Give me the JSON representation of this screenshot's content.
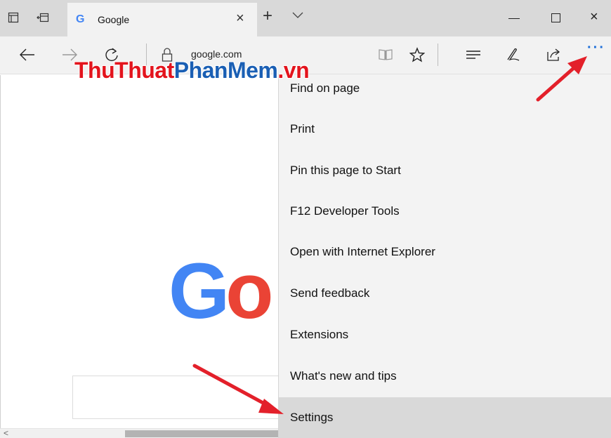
{
  "tab": {
    "title": "Google",
    "favicon_letter": "G"
  },
  "icons": {
    "tab-list": "tab-list-icon",
    "set-aside": "set-aside-tabs-icon",
    "new-tab": "plus-icon",
    "tab-preview": "chevron-down-icon",
    "back": "back-arrow-icon",
    "forward": "forward-arrow-icon",
    "refresh": "refresh-icon",
    "lock": "lock-icon",
    "reading-view": "book-icon",
    "favorite": "star-icon",
    "hub": "hub-icon",
    "web-note": "pen-icon",
    "share": "share-icon",
    "more": "more-dots-icon"
  },
  "window": {
    "close_glyph": "×",
    "tab_close_glyph": "×",
    "new_tab_glyph": "+"
  },
  "address": {
    "url": "google.com"
  },
  "watermark": {
    "part1": "ThuThuat",
    "part2": "PhanMem",
    "part3": ".vn"
  },
  "page": {
    "logo_letters": [
      "G",
      "o"
    ],
    "scroll_left_glyph": "<"
  },
  "menu": {
    "items": [
      {
        "label": "Find on page"
      },
      {
        "label": "Print"
      },
      {
        "label": "Pin this page to Start"
      },
      {
        "label": "F12 Developer Tools"
      },
      {
        "label": "Open with Internet Explorer"
      },
      {
        "label": "Send feedback"
      },
      {
        "label": "Extensions"
      },
      {
        "label": "What's new and tips"
      },
      {
        "label": "Settings",
        "selected": true
      }
    ]
  },
  "more_button": {
    "label": "···"
  },
  "colors": {
    "titlebar": "#d9d9d9",
    "toolbar": "#f2f2f2",
    "menu_bg": "#f3f3f3",
    "menu_selected": "#d9d9d9",
    "arrow": "#e3202a",
    "google_blue": "#4285F4",
    "google_red": "#EA4335",
    "accent": "#1e6fd9"
  }
}
